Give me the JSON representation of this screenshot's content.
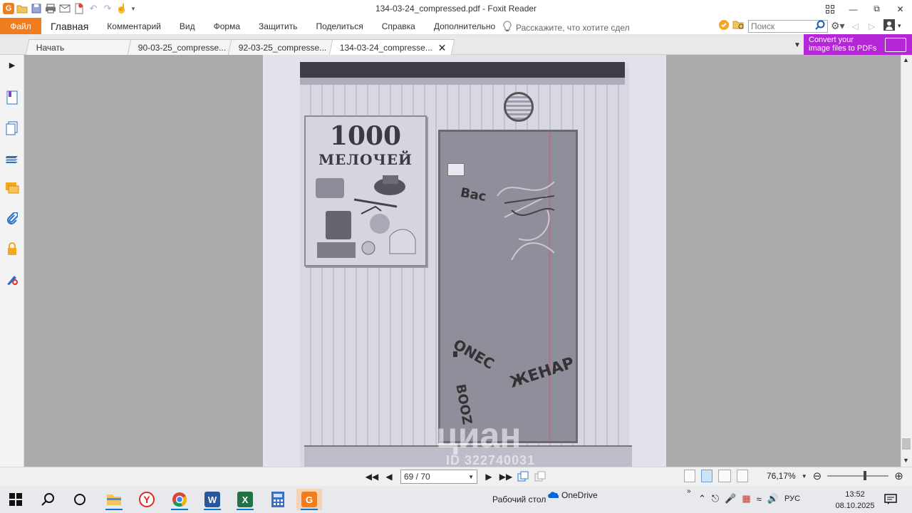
{
  "window": {
    "title": "134-03-24_compressed.pdf - Foxit Reader"
  },
  "ribbon": {
    "file_label": "Файл",
    "menu": [
      "Главная",
      "Комментарий",
      "Вид",
      "Форма",
      "Защитить",
      "Поделиться",
      "Справка",
      "Дополнительно"
    ],
    "tell_me": "Расскажите, что хотите сдел",
    "search_placeholder": "Поиск"
  },
  "tabs": [
    {
      "label": "Начать",
      "active": false
    },
    {
      "label": "90-03-25_compresse...",
      "active": false
    },
    {
      "label": "92-03-25_compresse...",
      "active": false
    },
    {
      "label": "134-03-24_compresse...",
      "active": true
    }
  ],
  "promo": {
    "line1": "Convert your",
    "line2": "image files to PDFs"
  },
  "document": {
    "poster_title": "1000",
    "poster_subtitle": "МЕЛОЧЕЙ",
    "graffiti": [
      "Вас",
      "ONEC",
      "ЖЕНАР",
      "BOOZ"
    ],
    "watermark_brand": "циан",
    "watermark_id": "ID 322740031"
  },
  "navigation": {
    "page_display": "69 / 70",
    "zoom": "76,17%",
    "zoom_level": 0.62
  },
  "taskbar": {
    "desktop_label": "Рабочий стол",
    "onedrive_label": "OneDrive",
    "language": "РУС",
    "time": "13:52",
    "date": "08.10.2025"
  },
  "colors": {
    "accent": "#f07e1e",
    "promo": "#b526d8",
    "workspace": "#ababab"
  }
}
